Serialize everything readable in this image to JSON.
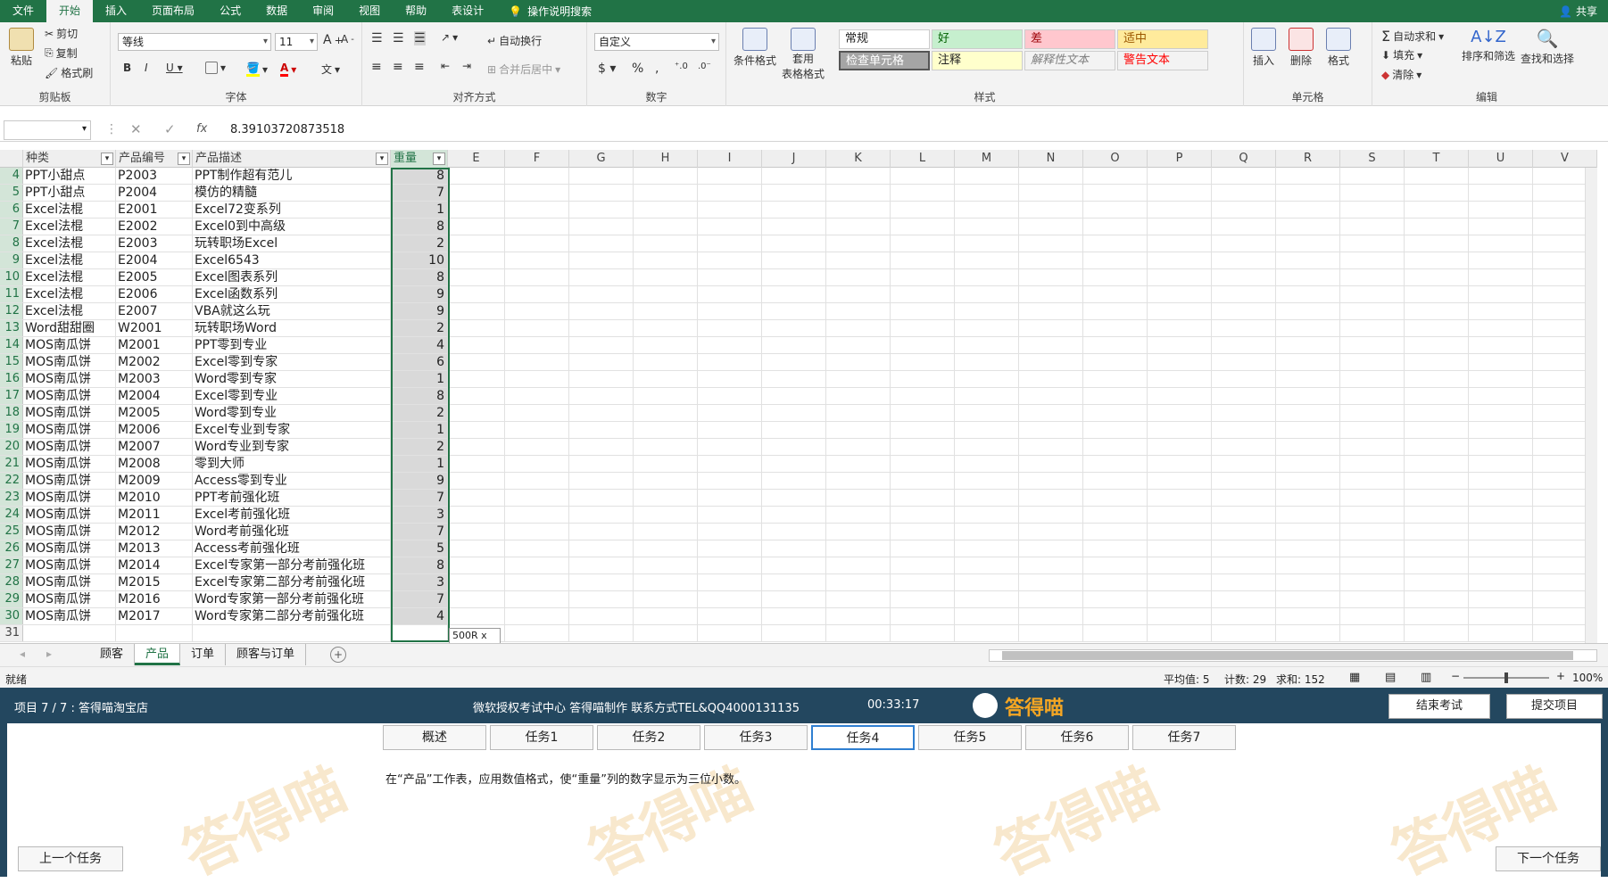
{
  "ribbon_tabs": [
    "文件",
    "开始",
    "插入",
    "页面布局",
    "公式",
    "数据",
    "审阅",
    "视图",
    "帮助",
    "表设计"
  ],
  "active_tab": "开始",
  "tell_me": "操作说明搜索",
  "share": "共享",
  "clipboard": {
    "paste": "粘贴",
    "cut": "剪切",
    "copy": "复制",
    "format_painter": "格式刷",
    "label": "剪贴板"
  },
  "font": {
    "name": "等线",
    "size": "11",
    "label": "字体"
  },
  "alignment": {
    "wrap": "自动换行",
    "merge": "合并后居中",
    "label": "对齐方式"
  },
  "number": {
    "format": "自定义",
    "label": "数字"
  },
  "styles": {
    "cond_format": "条件格式",
    "table_format_1": "套用",
    "table_format_2": "表格格式",
    "label": "样式",
    "cells": [
      {
        "text": "常规",
        "bg": "#ffffff",
        "color": "#222222"
      },
      {
        "text": "好",
        "bg": "#c6efce",
        "color": "#006100"
      },
      {
        "text": "差",
        "bg": "#ffc7ce",
        "color": "#9c0006"
      },
      {
        "text": "适中",
        "bg": "#ffeb9c",
        "color": "#9c5700"
      },
      {
        "text": "检查单元格",
        "bg": "#a5a5a5",
        "color": "#ffffff"
      },
      {
        "text": "注释",
        "bg": "#ffffcc",
        "color": "#222222"
      },
      {
        "text": "解释性文本",
        "bg": "#f3f3f3",
        "color": "#7f7f7f"
      },
      {
        "text": "警告文本",
        "bg": "#f3f3f3",
        "color": "#ff0000"
      }
    ]
  },
  "cells_group": {
    "insert": "插入",
    "delete": "删除",
    "format": "格式",
    "label": "单元格"
  },
  "editing": {
    "autosum": "自动求和",
    "fill": "填充",
    "clear": "清除",
    "sort": "排序和筛选",
    "find": "查找和选择",
    "label": "编辑"
  },
  "formula_bar": {
    "fx": "fx",
    "value": "8.39103720873518"
  },
  "columns": [
    "种类",
    "产品编号",
    "产品描述",
    "重量",
    "E",
    "F",
    "G",
    "H",
    "I",
    "J",
    "K",
    "L",
    "M",
    "N",
    "O",
    "P",
    "Q",
    "R",
    "S",
    "T",
    "U",
    "V"
  ],
  "rows": [
    {
      "n": "4",
      "a": "PPT小甜点",
      "b": "P2003",
      "c": "PPT制作超有范儿",
      "d": "8"
    },
    {
      "n": "5",
      "a": "PPT小甜点",
      "b": "P2004",
      "c": "模仿的精髓",
      "d": "7"
    },
    {
      "n": "6",
      "a": "Excel法棍",
      "b": "E2001",
      "c": "Excel72变系列",
      "d": "1"
    },
    {
      "n": "7",
      "a": "Excel法棍",
      "b": "E2002",
      "c": "Excel0到中高级",
      "d": "8"
    },
    {
      "n": "8",
      "a": "Excel法棍",
      "b": "E2003",
      "c": "玩转职场Excel",
      "d": "2"
    },
    {
      "n": "9",
      "a": "Excel法棍",
      "b": "E2004",
      "c": "Excel6543",
      "d": "10"
    },
    {
      "n": "10",
      "a": "Excel法棍",
      "b": "E2005",
      "c": "Excel图表系列",
      "d": "8"
    },
    {
      "n": "11",
      "a": "Excel法棍",
      "b": "E2006",
      "c": "Excel函数系列",
      "d": "9"
    },
    {
      "n": "12",
      "a": "Excel法棍",
      "b": "E2007",
      "c": "VBA就这么玩",
      "d": "9"
    },
    {
      "n": "13",
      "a": "Word甜甜圈",
      "b": "W2001",
      "c": "玩转职场Word",
      "d": "2"
    },
    {
      "n": "14",
      "a": "MOS南瓜饼",
      "b": "M2001",
      "c": "PPT零到专业",
      "d": "4"
    },
    {
      "n": "15",
      "a": "MOS南瓜饼",
      "b": "M2002",
      "c": "Excel零到专家",
      "d": "6"
    },
    {
      "n": "16",
      "a": "MOS南瓜饼",
      "b": "M2003",
      "c": "Word零到专家",
      "d": "1"
    },
    {
      "n": "17",
      "a": "MOS南瓜饼",
      "b": "M2004",
      "c": "Excel零到专业",
      "d": "8"
    },
    {
      "n": "18",
      "a": "MOS南瓜饼",
      "b": "M2005",
      "c": "Word零到专业",
      "d": "2"
    },
    {
      "n": "19",
      "a": "MOS南瓜饼",
      "b": "M2006",
      "c": "Excel专业到专家",
      "d": "1"
    },
    {
      "n": "20",
      "a": "MOS南瓜饼",
      "b": "M2007",
      "c": "Word专业到专家",
      "d": "2"
    },
    {
      "n": "21",
      "a": "MOS南瓜饼",
      "b": "M2008",
      "c": "零到大师",
      "d": "1"
    },
    {
      "n": "22",
      "a": "MOS南瓜饼",
      "b": "M2009",
      "c": "Access零到专业",
      "d": "9"
    },
    {
      "n": "23",
      "a": "MOS南瓜饼",
      "b": "M2010",
      "c": "PPT考前强化班",
      "d": "7"
    },
    {
      "n": "24",
      "a": "MOS南瓜饼",
      "b": "M2011",
      "c": "Excel考前强化班",
      "d": "3"
    },
    {
      "n": "25",
      "a": "MOS南瓜饼",
      "b": "M2012",
      "c": "Word考前强化班",
      "d": "7"
    },
    {
      "n": "26",
      "a": "MOS南瓜饼",
      "b": "M2013",
      "c": "Access考前强化班",
      "d": "5"
    },
    {
      "n": "27",
      "a": "MOS南瓜饼",
      "b": "M2014",
      "c": "Excel专家第一部分考前强化班",
      "d": "8"
    },
    {
      "n": "28",
      "a": "MOS南瓜饼",
      "b": "M2015",
      "c": "Excel专家第二部分考前强化班",
      "d": "3"
    },
    {
      "n": "29",
      "a": "MOS南瓜饼",
      "b": "M2016",
      "c": "Word专家第一部分考前强化班",
      "d": "7"
    },
    {
      "n": "30",
      "a": "MOS南瓜饼",
      "b": "M2017",
      "c": "Word专家第二部分考前强化班",
      "d": "4"
    },
    {
      "n": "31",
      "a": "",
      "b": "",
      "c": "",
      "d": ""
    }
  ],
  "selection_tip": "500R x 1C",
  "sheets": [
    "顾客",
    "产品",
    "订单",
    "顾客与订单"
  ],
  "active_sheet": "产品",
  "status": {
    "ready": "就绪",
    "avg": "平均值: 5",
    "count": "计数: 29",
    "sum": "求和: 152",
    "zoom": "100%"
  },
  "exam": {
    "project": "项目 7 / 7 :  答得喵淘宝店",
    "center": "微软授权考试中心 答得喵制作 联系方式TEL&QQ4000131135",
    "timer": "00:33:17",
    "brand": "答得喵",
    "end": "结束考试",
    "submit": "提交项目",
    "tasks": [
      "概述",
      "任务1",
      "任务2",
      "任务3",
      "任务4",
      "任务5",
      "任务6",
      "任务7"
    ],
    "active_task": "任务4",
    "instruction": "在“产品”工作表，应用数值格式，使“重量”列的数字显示为三位小数。",
    "prev": "上一个任务",
    "next": "下一个任务",
    "watermark": "答得喵"
  }
}
